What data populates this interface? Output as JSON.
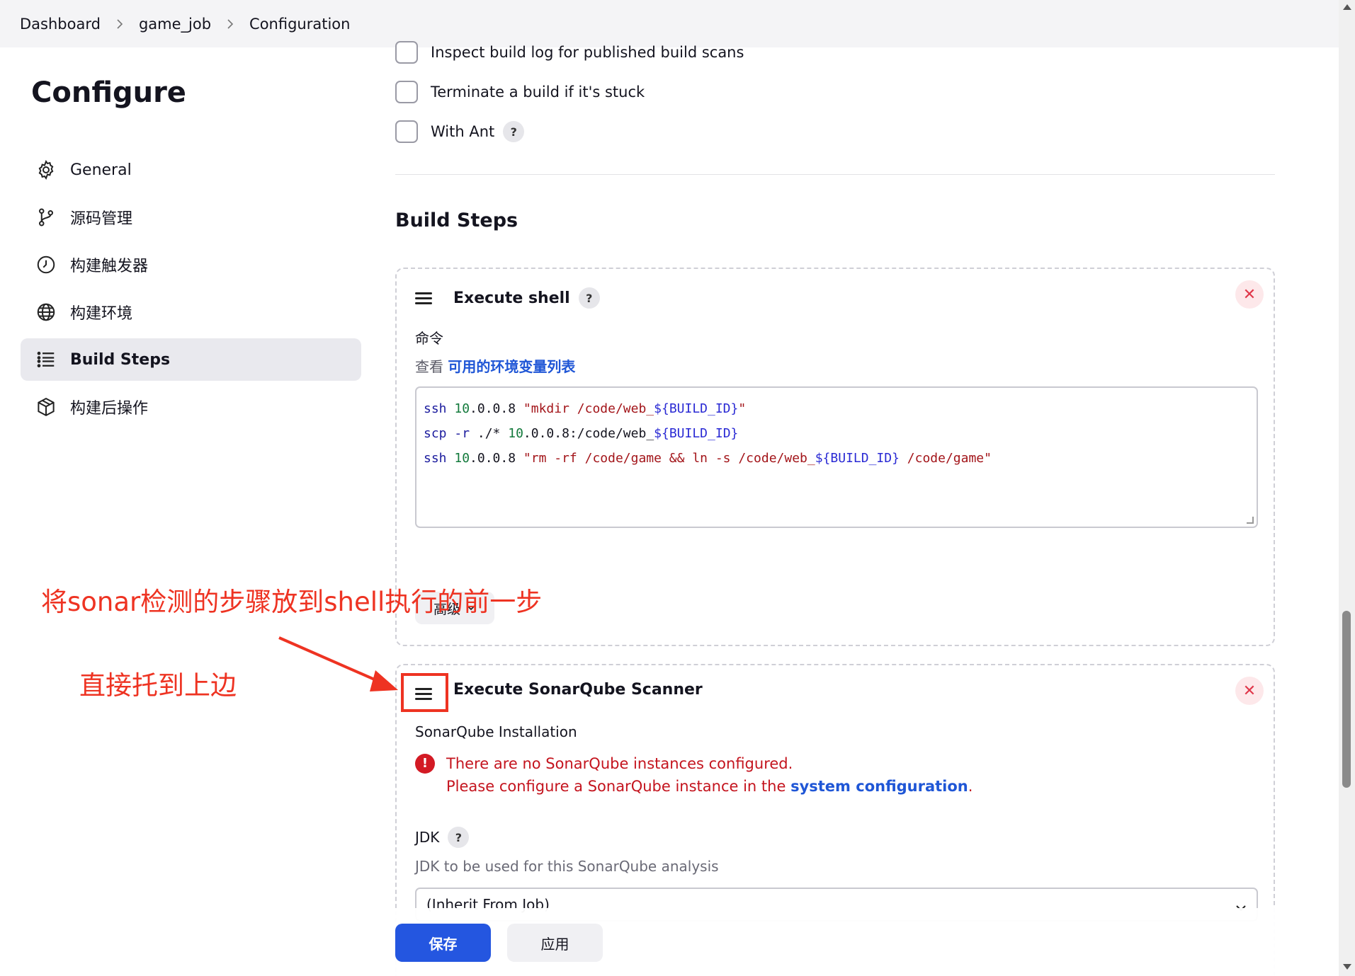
{
  "breadcrumb": {
    "items": [
      "Dashboard",
      "game_job",
      "Configuration"
    ]
  },
  "sidebar": {
    "title": "Configure",
    "items": [
      {
        "label": "General",
        "icon": "gear-icon"
      },
      {
        "label": "源码管理",
        "icon": "branch-icon"
      },
      {
        "label": "构建触发器",
        "icon": "clock-icon"
      },
      {
        "label": "构建环境",
        "icon": "globe-icon"
      },
      {
        "label": "Build Steps",
        "icon": "list-icon",
        "active": true
      },
      {
        "label": "构建后操作",
        "icon": "package-icon"
      }
    ]
  },
  "options": {
    "inspect_label": "Inspect build log for published build scans",
    "terminate_label": "Terminate a build if it's stuck",
    "ant_label": "With Ant",
    "help_mark": "?"
  },
  "build_steps": {
    "title": "Build Steps",
    "shell": {
      "title": "Execute shell",
      "command_label": "命令",
      "env_prefix": "查看",
      "env_link": "可用的环境变量列表",
      "lines": [
        "ssh 10.0.0.8 \"mkdir /code/web_${BUILD_ID}\"",
        "scp -r ./* 10.0.0.8:/code/web_${BUILD_ID}",
        "ssh 10.0.0.8 \"rm -rf /code/game && ln -s /code/web_${BUILD_ID} /code/game\""
      ],
      "advanced_label": "高级"
    },
    "sonar": {
      "title": "Execute SonarQube Scanner",
      "installation_label": "SonarQube Installation",
      "error_line1": "There are no SonarQube instances configured.",
      "error_line2_prefix": "Please configure a SonarQube instance in the",
      "error_link": "system configuration",
      "error_suffix": ".",
      "jdk_label": "JDK",
      "jdk_desc": "JDK to be used for this SonarQube analysis",
      "jdk_selected": "(Inherit From Job)"
    }
  },
  "actions": {
    "save": "保存",
    "apply": "应用"
  },
  "annotations": {
    "text1": "将sonar检测的步骤放到shell执行的前一步",
    "text2": "直接托到上边",
    "color": "#ee3322"
  },
  "colors": {
    "primary": "#2456e0",
    "error": "#c4141e",
    "link": "#1f56d6"
  }
}
